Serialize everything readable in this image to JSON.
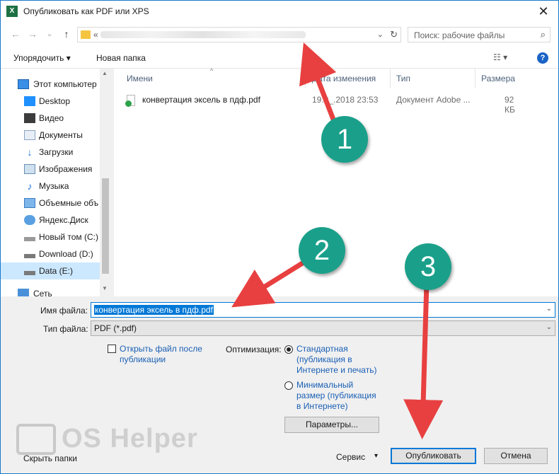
{
  "window": {
    "title": "Опубликовать как PDF или XPS",
    "app_icon": "X",
    "close": "✕"
  },
  "nav": {
    "back": "←",
    "forward": "→",
    "dropdown": "⌄",
    "up": "↑",
    "address_prefix": "«",
    "search_placeholder": "Поиск: рабочие файлы",
    "search_icon": "⌕",
    "refresh": "↻"
  },
  "toolbar": {
    "organize": "Упорядочить ▾",
    "new_folder": "Новая папка",
    "view": "☷ ▾",
    "help": "?"
  },
  "tree": [
    {
      "label": "Этот компьютер",
      "icon": "computer-icon",
      "root": true
    },
    {
      "label": "Desktop",
      "icon": "desktop-icon"
    },
    {
      "label": "Видео",
      "icon": "video-icon"
    },
    {
      "label": "Документы",
      "icon": "documents-icon"
    },
    {
      "label": "Загрузки",
      "icon": "downloads-icon"
    },
    {
      "label": "Изображения",
      "icon": "images-icon"
    },
    {
      "label": "Музыка",
      "icon": "music-icon"
    },
    {
      "label": "Объемные объ",
      "icon": "3d-objects-icon"
    },
    {
      "label": "Яндекс.Диск",
      "icon": "cloud-icon"
    },
    {
      "label": "Новый том (C:)",
      "icon": "drive-icon"
    },
    {
      "label": "Download (D:)",
      "icon": "drive-icon"
    },
    {
      "label": "Data (E:)",
      "icon": "drive-icon",
      "selected": true
    },
    {
      "label": "Сеть",
      "icon": "network-icon",
      "root": true
    }
  ],
  "columns": {
    "name": "Имени",
    "date": "Дата изменения",
    "type": "Тип",
    "size": "Размера"
  },
  "files": [
    {
      "name": "конвертация эксель в пдф.pdf",
      "date": "19.0_.2018 23:53",
      "type": "Документ Adobe ...",
      "size": "92 КБ"
    }
  ],
  "form": {
    "filename_label": "Имя файла:",
    "filename_value": "конвертация эксель в пдф.pdf",
    "filetype_label": "Тип файла:",
    "filetype_value": "PDF (*.pdf)",
    "open_after_line1": "Открыть файл после",
    "open_after_line2": "публикации",
    "optimize_label": "Оптимизация:",
    "opt_standard": [
      "Стандартная",
      "(публикация в",
      "Интернете и печать)"
    ],
    "opt_min": [
      "Минимальный",
      "размер (публикация",
      "в Интернете)"
    ],
    "params_button": "Параметры..."
  },
  "footer": {
    "hide_folders": "Скрыть папки",
    "service": "Сервис",
    "service_arrow": "▾",
    "publish": "Опубликовать",
    "cancel": "Отмена"
  },
  "annotations": {
    "badge1": "1",
    "badge2": "2",
    "badge3": "3",
    "color": "#1aa08a",
    "arrow_color": "#e84040"
  },
  "watermark": {
    "text": "OS Helper"
  }
}
